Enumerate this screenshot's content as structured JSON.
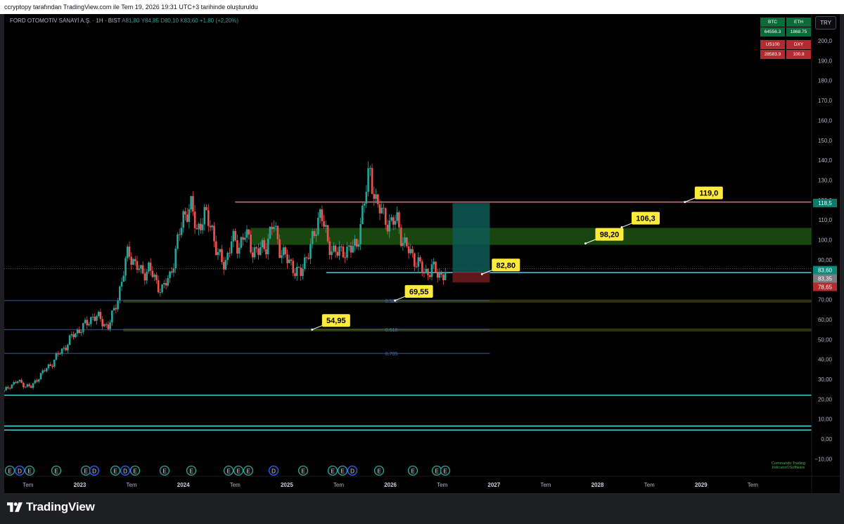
{
  "header": {
    "credit": "ccryptopy tarafından TradingView.com ile Tem 19, 2026 19:31 UTC+3 tarihinde oluşturuldu"
  },
  "legend": {
    "symbol": "FORD OTOMOTİV SANAYİ A.Ş. · 1H · BIST",
    "o_label": "A",
    "o_val": "81,80",
    "h_label": "Y",
    "h_val": "84,85",
    "l_label": "D",
    "l_val": "80,10",
    "c_label": "K",
    "c_val": "83,60",
    "change": "+1,80 (+2,20%)"
  },
  "currency_button": "TRY",
  "mini_table": {
    "btc_label": "BTC",
    "btc_val": "64556.3",
    "eth_label": "ETH",
    "eth_val": "1868.75",
    "us100_label": "US100",
    "us100_val": "28583.9",
    "dxy_label": "DXY",
    "dxy_val": "100.8",
    "green": "#0b6b3a",
    "red": "#b22b2f"
  },
  "watermark": "Commando Trading Indicator©Software",
  "brand": "TradingView",
  "chart_data": {
    "type": "line",
    "title": "",
    "ylim": [
      -10,
      200
    ],
    "y_ticks": [
      "200,0",
      "190,0",
      "180,0",
      "170,0",
      "160,0",
      "150,0",
      "140,0",
      "130,0",
      "120,0",
      "110,0",
      "100,0",
      "90,00",
      "80,00",
      "70,00",
      "60,00",
      "50,00",
      "40,00",
      "30,00",
      "20,00",
      "10,00",
      "0,00",
      "−10,00"
    ],
    "x_ticks": [
      {
        "label": "Tem",
        "bold": false,
        "t": 2022.5
      },
      {
        "label": "2023",
        "bold": true,
        "t": 2023.0
      },
      {
        "label": "Tem",
        "bold": false,
        "t": 2023.5
      },
      {
        "label": "2024",
        "bold": true,
        "t": 2024.0
      },
      {
        "label": "Tem",
        "bold": false,
        "t": 2024.5
      },
      {
        "label": "2025",
        "bold": true,
        "t": 2025.0
      },
      {
        "label": "Tem",
        "bold": false,
        "t": 2025.5
      },
      {
        "label": "2026",
        "bold": true,
        "t": 2026.0
      },
      {
        "label": "Tem",
        "bold": false,
        "t": 2026.5
      },
      {
        "label": "2027",
        "bold": true,
        "t": 2027.0
      },
      {
        "label": "Tem",
        "bold": false,
        "t": 2027.5
      },
      {
        "label": "2028",
        "bold": true,
        "t": 2028.0
      },
      {
        "label": "Tem",
        "bold": false,
        "t": 2028.5
      },
      {
        "label": "2029",
        "bold": true,
        "t": 2029.0
      },
      {
        "label": "Tem",
        "bold": false,
        "t": 2029.5
      }
    ],
    "xlim": [
      2022.27,
      2029.98
    ],
    "price_series": {
      "t": [
        2022.27,
        2022.33,
        2022.4,
        2022.47,
        2022.53,
        2022.6,
        2022.67,
        2022.73,
        2022.8,
        2022.87,
        2022.93,
        2023.0,
        2023.07,
        2023.13,
        2023.2,
        2023.27,
        2023.33,
        2023.4,
        2023.47,
        2023.53,
        2023.6,
        2023.67,
        2023.73,
        2023.8,
        2023.87,
        2023.93,
        2024.0,
        2024.07,
        2024.13,
        2024.2,
        2024.27,
        2024.33,
        2024.4,
        2024.47,
        2024.53,
        2024.6,
        2024.67,
        2024.73,
        2024.8,
        2024.87,
        2024.93,
        2025.0,
        2025.07,
        2025.13,
        2025.2,
        2025.27,
        2025.33,
        2025.4,
        2025.47,
        2025.53,
        2025.6,
        2025.67,
        2025.73,
        2025.8,
        2025.87,
        2025.93,
        2026.0,
        2026.07,
        2026.1,
        2026.13,
        2026.2,
        2026.27,
        2026.33,
        2026.4,
        2026.47,
        2026.53
      ],
      "close": [
        24,
        27,
        29,
        27,
        26,
        31,
        35,
        38,
        43,
        47,
        52,
        55,
        58,
        62,
        60,
        56,
        64,
        78,
        95,
        88,
        83,
        86,
        79,
        75,
        82,
        95,
        112,
        117,
        105,
        112,
        108,
        92,
        88,
        100,
        97,
        103,
        95,
        94,
        98,
        108,
        96,
        90,
        86,
        82,
        94,
        102,
        117,
        95,
        96,
        92,
        97,
        95,
        115,
        134,
        118,
        112,
        108,
        110,
        103,
        98,
        93,
        88,
        83,
        86,
        82,
        84
      ]
    },
    "levels": [
      {
        "name": "resistance-119",
        "y": 119.0,
        "color": "#f06a7a"
      },
      {
        "name": "support-83",
        "y": 83.6,
        "color": "#4dd0e1"
      },
      {
        "name": "support-22",
        "y": 22.0,
        "color": "#4dd0e1"
      },
      {
        "name": "support-7",
        "y": 6.5,
        "color": "#4dd0e1"
      },
      {
        "name": "support-5",
        "y": 4.5,
        "color": "#4dd0e1"
      }
    ],
    "fib_levels": [
      {
        "label": "0.500",
        "y": 69.55
      },
      {
        "label": "0.618",
        "y": 54.95
      },
      {
        "label": "0.705",
        "y": 43.0
      }
    ],
    "zones": [
      {
        "name": "green-zone",
        "y_low": 97.5,
        "y_high": 106.0,
        "color": "#2e7d1a"
      },
      {
        "name": "fib-500-band",
        "y_low": 68.5,
        "y_high": 70.0,
        "color": "#5a5a18"
      },
      {
        "name": "fib-618-band",
        "y_low": 54.0,
        "y_high": 55.5,
        "color": "#5a5a18"
      }
    ],
    "position_box": {
      "t_start": 2026.6,
      "t_end": 2026.96,
      "entry": 83.6,
      "target": 118.5,
      "stop": 78.65
    },
    "callouts": [
      {
        "text": "119,0",
        "value": 119.0,
        "t": 2028.98
      },
      {
        "text": "106,3",
        "value": 106.3,
        "t": 2028.37
      },
      {
        "text": "98,20",
        "value": 98.2,
        "t": 2028.02
      },
      {
        "text": "82,80",
        "value": 82.8,
        "t": 2027.02
      },
      {
        "text": "69,55",
        "value": 69.55,
        "t": 2026.18
      },
      {
        "text": "54,95",
        "value": 54.95,
        "t": 2025.38
      }
    ],
    "price_tags": [
      {
        "text": "118,5",
        "value": 118.5,
        "color": "#0a7a6a"
      },
      {
        "text": "83,60",
        "value": 84.8,
        "color": "#0a8a7a"
      },
      {
        "text": "83,35",
        "value": 80.6,
        "color": "#7c7c80"
      },
      {
        "text": "78,65",
        "value": 76.4,
        "color": "#b22b2f"
      }
    ],
    "earnings_marks": [
      "E",
      "D",
      "E",
      "E",
      "E",
      "D",
      "E",
      "D",
      "E",
      "E",
      "E",
      "E",
      "E",
      "E",
      "D",
      "E",
      "E",
      "E",
      "D",
      "E",
      "E",
      "E",
      "E"
    ]
  }
}
